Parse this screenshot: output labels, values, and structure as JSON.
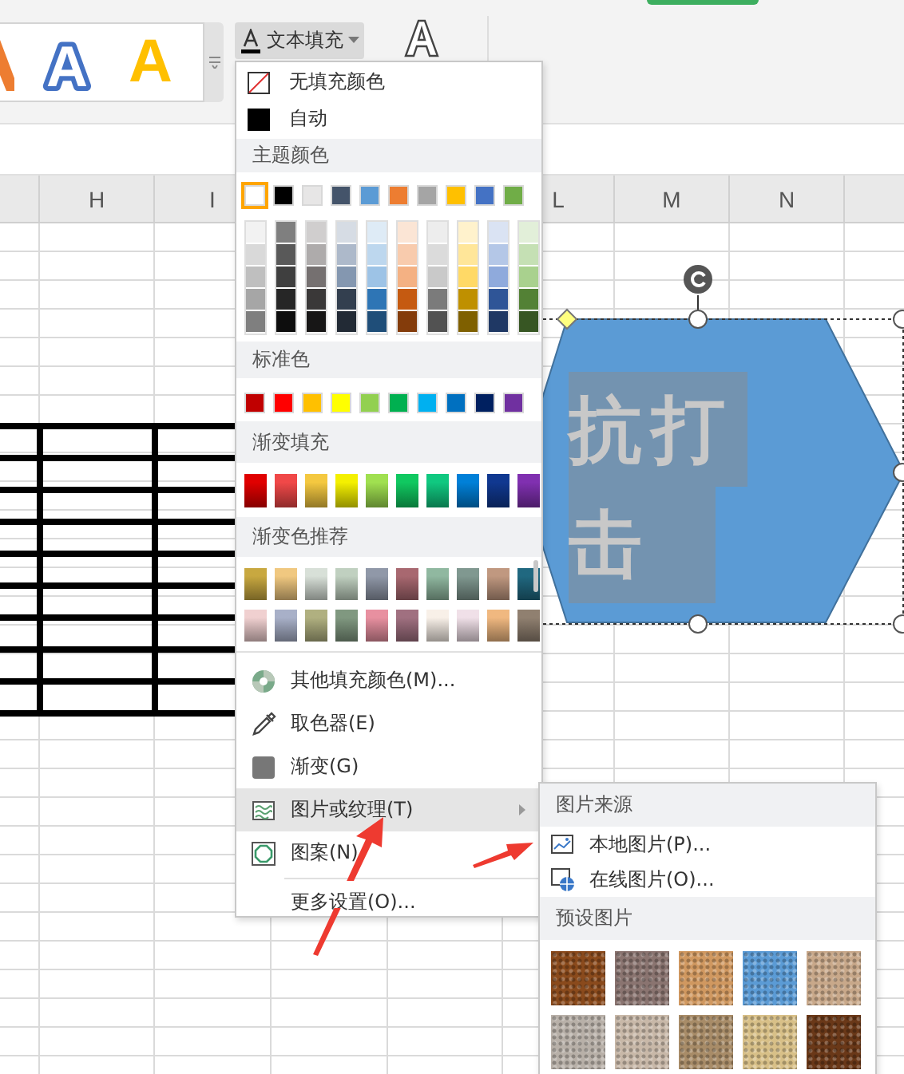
{
  "ribbon": {
    "style_gallery": [
      {
        "kind": "clipped",
        "color": "#ed7d31"
      },
      {
        "glyph": "A",
        "kind": "outline"
      },
      {
        "glyph": "A",
        "kind": "filled",
        "color": "#ffc000"
      }
    ],
    "text_fill_button": {
      "label": "文本填充"
    }
  },
  "sheet": {
    "columns_left": [
      "H",
      "I"
    ],
    "columns_right": [
      "L",
      "M",
      "N"
    ]
  },
  "shape": {
    "text": "抗打击"
  },
  "text_fill_menu": {
    "items_top": [
      {
        "label": "无填充颜色",
        "kind": "none"
      },
      {
        "label": "自动",
        "kind": "auto"
      }
    ],
    "theme": {
      "title": "主题颜色",
      "base": [
        {
          "color": "#ffffff",
          "selected": true,
          "shades": [
            {
              "color": "#f2f2f2"
            },
            {
              "color": "#d9d9d9"
            },
            {
              "color": "#bfbfbf"
            },
            {
              "color": "#a6a6a6"
            },
            {
              "color": "#7f7f7f"
            }
          ]
        },
        {
          "color": "#000000",
          "selected": false,
          "shades": [
            {
              "color": "#7f7f7f"
            },
            {
              "color": "#595959"
            },
            {
              "color": "#3f3f3f"
            },
            {
              "color": "#262626"
            },
            {
              "color": "#0d0d0d"
            }
          ]
        },
        {
          "color": "#e7e6e6",
          "selected": false,
          "shades": [
            {
              "color": "#d0cece"
            },
            {
              "color": "#aeabab"
            },
            {
              "color": "#757070"
            },
            {
              "color": "#3a3838"
            },
            {
              "color": "#171616"
            }
          ]
        },
        {
          "color": "#44546a",
          "selected": false,
          "shades": [
            {
              "color": "#d6dce4"
            },
            {
              "color": "#adb9ca"
            },
            {
              "color": "#8497b0"
            },
            {
              "color": "#333f4f"
            },
            {
              "color": "#222a35"
            }
          ]
        },
        {
          "color": "#5b9bd5",
          "selected": false,
          "shades": [
            {
              "color": "#deebf6"
            },
            {
              "color": "#bdd7ee"
            },
            {
              "color": "#9dc3e6"
            },
            {
              "color": "#2e75b5"
            },
            {
              "color": "#1f4e79"
            }
          ]
        },
        {
          "color": "#ed7d31",
          "selected": false,
          "shades": [
            {
              "color": "#fbe5d5"
            },
            {
              "color": "#f8cbad"
            },
            {
              "color": "#f4b183"
            },
            {
              "color": "#c55a11"
            },
            {
              "color": "#843c0b"
            }
          ]
        },
        {
          "color": "#a5a5a5",
          "selected": false,
          "shades": [
            {
              "color": "#ededed"
            },
            {
              "color": "#dbdbdb"
            },
            {
              "color": "#c9c9c9"
            },
            {
              "color": "#7b7b7b"
            },
            {
              "color": "#525252"
            }
          ]
        },
        {
          "color": "#ffc000",
          "selected": false,
          "shades": [
            {
              "color": "#fff2cc"
            },
            {
              "color": "#ffe699"
            },
            {
              "color": "#ffd966"
            },
            {
              "color": "#bf9000"
            },
            {
              "color": "#7f6000"
            }
          ]
        },
        {
          "color": "#4472c4",
          "selected": false,
          "shades": [
            {
              "color": "#dae3f3"
            },
            {
              "color": "#b4c7e7"
            },
            {
              "color": "#8faadc"
            },
            {
              "color": "#2f5597"
            },
            {
              "color": "#1f3864"
            }
          ]
        },
        {
          "color": "#70ad47",
          "selected": false,
          "shades": [
            {
              "color": "#e2efd9"
            },
            {
              "color": "#c5e0b4"
            },
            {
              "color": "#a9d18e"
            },
            {
              "color": "#538135"
            },
            {
              "color": "#375623"
            }
          ]
        }
      ]
    },
    "standard": {
      "title": "标准色",
      "colors": [
        {
          "color": "#c00000"
        },
        {
          "color": "#ff0000"
        },
        {
          "color": "#ffc000"
        },
        {
          "color": "#ffff00"
        },
        {
          "color": "#92d050"
        },
        {
          "color": "#00b050"
        },
        {
          "color": "#00b0f0"
        },
        {
          "color": "#0070c0"
        },
        {
          "color": "#002060"
        },
        {
          "color": "#7030a0"
        }
      ]
    },
    "gradient_fill": {
      "title": "渐变填充",
      "swatches": [
        {
          "color": "#e00000"
        },
        {
          "color": "#f04848"
        },
        {
          "color": "#f4c840"
        },
        {
          "color": "#f4f000"
        },
        {
          "color": "#a0e050"
        },
        {
          "color": "#10c860"
        },
        {
          "color": "#10c880"
        },
        {
          "color": "#0080d8"
        },
        {
          "color": "#103890"
        },
        {
          "color": "#8030b0"
        }
      ]
    },
    "gradient_presets": {
      "title": "渐变色推荐",
      "swatches": [
        {
          "color": "#c8a840"
        },
        {
          "color": "#f0c880"
        },
        {
          "color": "#d8e0d8"
        },
        {
          "color": "#c0d0c0"
        },
        {
          "color": "#9098a8"
        },
        {
          "color": "#a86870"
        },
        {
          "color": "#90b8a0"
        },
        {
          "color": "#809890"
        },
        {
          "color": "#c09880"
        },
        {
          "color": "#206880"
        },
        {
          "color": "#f0d0d0"
        },
        {
          "color": "#a8b0c8"
        },
        {
          "color": "#b0b080"
        },
        {
          "color": "#809880"
        },
        {
          "color": "#e890a0"
        },
        {
          "color": "#a07080"
        },
        {
          "color": "#f8f0e8"
        },
        {
          "color": "#f0e0e8"
        },
        {
          "color": "#f0b880"
        },
        {
          "color": "#908070"
        }
      ]
    },
    "items": [
      {
        "label": "其他填充颜色(M)...",
        "kind": "palette",
        "selected": false,
        "submenu": false
      },
      {
        "label": "取色器(E)",
        "kind": "eyedropper",
        "selected": false,
        "submenu": false
      },
      {
        "label": "渐变(G)",
        "kind": "gradient",
        "selected": false,
        "submenu": false
      },
      {
        "label": "图片或纹理(T)",
        "kind": "texture",
        "selected": true,
        "submenu": true
      },
      {
        "label": "图案(N)",
        "kind": "pattern",
        "selected": false,
        "submenu": false
      },
      {
        "label": "更多设置(O)...",
        "kind": "more",
        "selected": false,
        "submenu": false
      }
    ]
  },
  "picture_menu": {
    "source_title": "图片来源",
    "items": [
      {
        "label": "本地图片(P)...",
        "kind": "local"
      },
      {
        "label": "在线图片(O)...",
        "kind": "online"
      }
    ],
    "preset_title": "预设图片",
    "textures": [
      {
        "color": "#8a4a1c"
      },
      {
        "color": "#8a7470"
      },
      {
        "color": "#d09860"
      },
      {
        "color": "#5b9bd5"
      },
      {
        "color": "#c8a88a"
      },
      {
        "color": "#b8b0a8"
      },
      {
        "color": "#c8b8a8"
      },
      {
        "color": "#a88c68"
      },
      {
        "color": "#d8c088"
      },
      {
        "color": "#6a3818"
      }
    ]
  }
}
